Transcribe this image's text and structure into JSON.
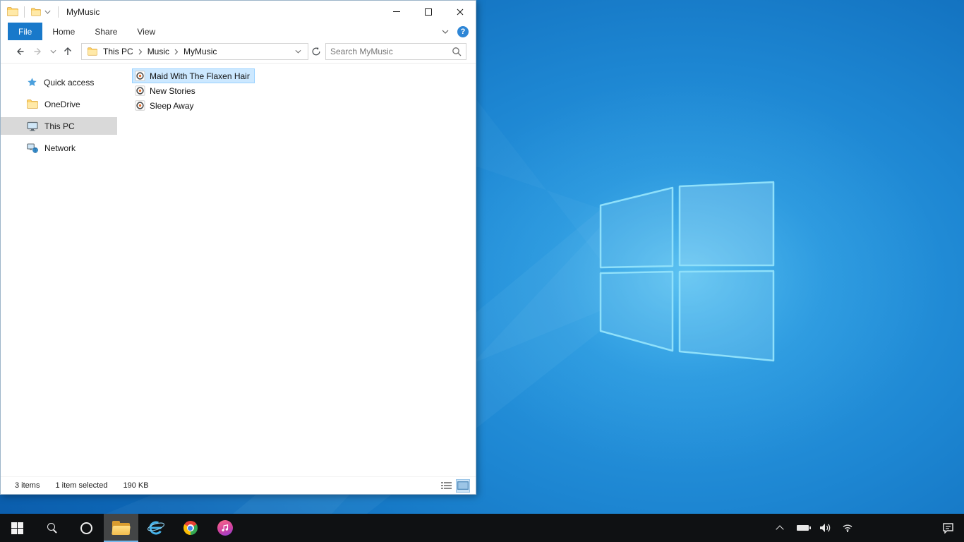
{
  "explorer": {
    "titlebar": {
      "title": "MyMusic"
    },
    "ribbon": {
      "tabs": [
        {
          "label": "File",
          "active": true
        },
        {
          "label": "Home",
          "active": false
        },
        {
          "label": "Share",
          "active": false
        },
        {
          "label": "View",
          "active": false
        }
      ]
    },
    "addressbar": {
      "breadcrumb": [
        "This PC",
        "Music",
        "MyMusic"
      ],
      "search_placeholder": "Search MyMusic"
    },
    "sidebar": {
      "items": [
        {
          "label": "Quick access",
          "icon": "star-icon",
          "selected": false
        },
        {
          "label": "OneDrive",
          "icon": "folder-icon",
          "selected": false
        },
        {
          "label": "This PC",
          "icon": "computer-icon",
          "selected": true
        },
        {
          "label": "Network",
          "icon": "network-icon",
          "selected": false
        }
      ]
    },
    "files": [
      {
        "name": "Maid With The Flaxen Hair",
        "icon": "audio-file-icon",
        "selected": true
      },
      {
        "name": "New Stories",
        "icon": "audio-file-icon",
        "selected": false
      },
      {
        "name": "Sleep Away",
        "icon": "audio-file-icon",
        "selected": false
      }
    ],
    "statusbar": {
      "item_count": "3 items",
      "selection": "1 item selected",
      "size": "190 KB"
    }
  },
  "taskbar": {
    "buttons": [
      "start",
      "search",
      "cortana",
      "file-explorer",
      "internet-explorer",
      "chrome",
      "itunes"
    ],
    "active_button": "file-explorer",
    "tray": [
      "show-hidden-icons",
      "battery",
      "volume",
      "network",
      "action-center"
    ]
  },
  "colors": {
    "accent": "#0078d7",
    "file_tab": "#1979ca",
    "selection_bg": "#cce8ff",
    "selection_border": "#99d1ff",
    "sidebar_selected": "#d9d9d9",
    "taskbar_bg": "#0f1113",
    "wallpaper_base": "#0e69b8",
    "wallpaper_glow": "#7fdcf8"
  }
}
